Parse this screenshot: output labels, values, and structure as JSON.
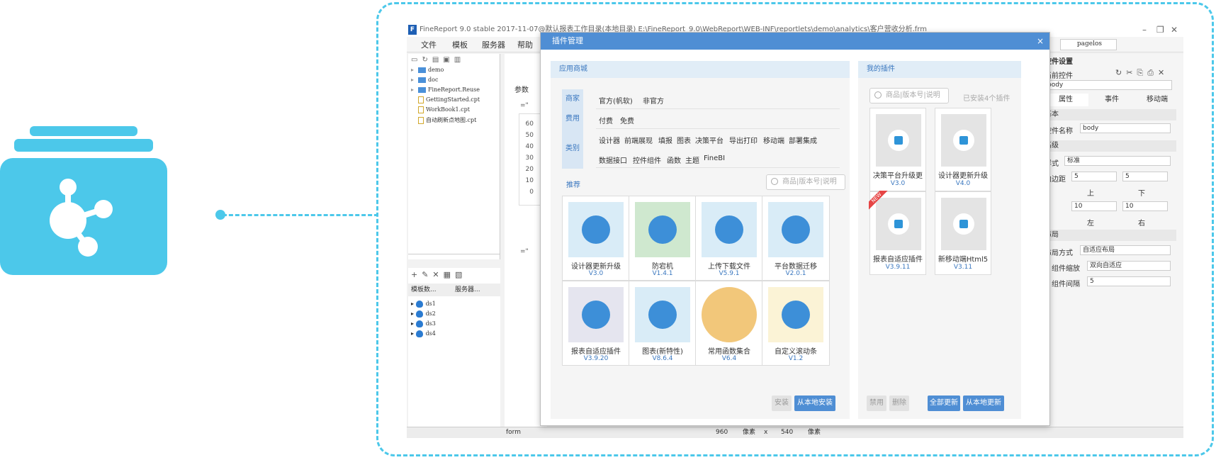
{
  "app": {
    "title": "FineReport 9.0 stable 2017-11-07@默认报表工作目录(本地目录)   E:\\FineReport_9.0\\WebReport\\WEB-INF\\reportlets\\demo\\analytics\\客户营收分析.frm",
    "menu": [
      "文件",
      "模板",
      "服务器",
      "帮助"
    ],
    "tree": [
      "demo",
      "doc",
      "FineReport.Reuse",
      "GettingStarted.cpt",
      "WorkBook1.cpt",
      "自动刷新点地图.cpt"
    ],
    "datasource_tabs": [
      "模板数...",
      "服务器..."
    ],
    "datasets": [
      "ds1",
      "ds2",
      "ds3",
      "ds4"
    ],
    "center_label": "参数",
    "y_values": [
      "60",
      "50",
      "40",
      "30",
      "20",
      "10",
      "0"
    ],
    "formula_marks": [
      "=\"",
      "=\""
    ],
    "status": {
      "left": "form",
      "w": "960",
      "unit1": "像素",
      "x": "x",
      "h": "540",
      "unit2": "像素"
    }
  },
  "right_panel": {
    "top_input": "pagelos",
    "title": "控件设置",
    "current_widget_label": "当前控件",
    "widget_select": "body",
    "tabs": [
      "属性",
      "事件",
      "移动端"
    ],
    "basic": "基本",
    "name_label": "控件名称",
    "name_value": "body",
    "advanced": "高级",
    "style_label": "样式",
    "style_value": "标准",
    "padding_label": "内边距",
    "padding_values": [
      "5",
      "5",
      "10",
      "10"
    ],
    "dir_labels": [
      "上",
      "下",
      "左",
      "右"
    ],
    "layout": "布局",
    "layout_mode_label": "布局方式",
    "layout_mode_value": "自适应布局",
    "scale_label": "组件缩放",
    "scale_value": "双向自适应",
    "gap_label": "组件间隔",
    "gap_value": "5"
  },
  "dialog": {
    "title": "插件管理",
    "close": "×",
    "store": {
      "title": "应用商城",
      "tabs": [
        "商家",
        "费用",
        "类别"
      ],
      "merchants": [
        "官方(帆软)",
        "非官方"
      ],
      "fees": [
        "付费",
        "免费"
      ],
      "categories_row1": [
        "设计器",
        "前端展现",
        "填报",
        "图表",
        "决策平台",
        "导出打印",
        "移动端",
        "部署集成"
      ],
      "categories_row2": [
        "数据接口",
        "控件组件",
        "函数",
        "主题",
        "FineBI"
      ],
      "recommend": "推荐",
      "search_placeholder": "商品|版本号|说明",
      "plugins": [
        {
          "name": "设计器更新升级",
          "version": "V3.0",
          "color": "#d9ecf7"
        },
        {
          "name": "防宕机",
          "version": "V1.4.1",
          "color": "#cfe8cf"
        },
        {
          "name": "上传下载文件",
          "version": "V5.9.1",
          "color": "#d9ecf7"
        },
        {
          "name": "平台数据迁移",
          "version": "V2.0.1",
          "color": "#d9ecf7"
        },
        {
          "name": "报表自适应插件",
          "version": "V3.9.20",
          "color": "#e5e5ef"
        },
        {
          "name": "图表(新特性)",
          "version": "V8.6.4",
          "color": "#d9ecf7"
        },
        {
          "name": "常用函数集合",
          "version": "V6.4",
          "color": "#ffffff"
        },
        {
          "name": "自定义滚动条",
          "version": "V1.2",
          "color": "#fbf3d6"
        }
      ],
      "install_button": "安装",
      "install_local_button": "从本地安装"
    },
    "mine": {
      "title": "我的插件",
      "search_placeholder": "商品|版本号|说明",
      "installed_count": "已安装4个插件",
      "plugins": [
        {
          "name": "决策平台升级更",
          "version": "V3.0",
          "new": false
        },
        {
          "name": "设计器更新升级",
          "version": "V4.0",
          "new": false
        },
        {
          "name": "报表自适应插件",
          "version": "V3.9.11",
          "new": true
        },
        {
          "name": "新移动端Html5",
          "version": "V3.11",
          "new": false
        }
      ],
      "new_tag": "NEW",
      "disable_button": "禁用",
      "delete_button": "删除",
      "update_all_button": "全部更新",
      "update_local_button": "从本地更新"
    }
  },
  "colors": {
    "accent": "#4cc8ea",
    "dialog_blue": "#4f8ed4",
    "link": "#3a77bf"
  }
}
